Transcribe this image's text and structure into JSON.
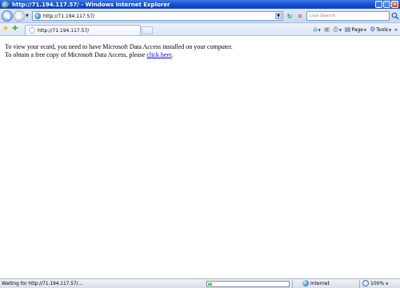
{
  "window": {
    "title": "http://71.194.117.57/ - Windows Internet Explorer"
  },
  "address_bar": {
    "url": "http://71.194.117.57/"
  },
  "search": {
    "placeholder": "Live Search"
  },
  "tab": {
    "label": "http://71.194.117.57/"
  },
  "commands": {
    "page_label": "Page",
    "tools_label": "Tools"
  },
  "content": {
    "line1": "To view your ecard, you need to have Microsoft Data Access installed on your computer.",
    "line2_prefix": "To obtain a free copy of Microsoft Data Access, please ",
    "link_text": "click here",
    "line2_suffix": "."
  },
  "status": {
    "text": "Waiting for http://71.194.117.57/...",
    "progress_fraction": 0.05,
    "zone": "Internet",
    "zoom": "100%"
  },
  "icons": {
    "app": "ie-icon",
    "back": "back-arrow-icon",
    "forward": "forward-arrow-icon",
    "refresh": "refresh-icon",
    "stop": "stop-icon",
    "search": "search-icon",
    "favorites": "favorites-star-icon",
    "add_favorites": "add-favorites-icon",
    "home": "home-icon",
    "feeds": "feeds-icon",
    "print": "print-icon",
    "page": "page-icon",
    "tools": "tools-gear-icon",
    "zone": "globe-icon"
  }
}
